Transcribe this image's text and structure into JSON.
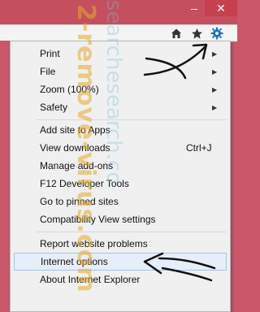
{
  "window": {
    "minimize_glyph": "–",
    "close_glyph": "✕"
  },
  "toolbar": {
    "icons": [
      "home-icon",
      "favorites-star-icon",
      "tools-gear-icon"
    ]
  },
  "menu": {
    "items": [
      {
        "label": "Print",
        "has_submenu": true
      },
      {
        "label": "File",
        "has_submenu": true
      },
      {
        "label": "Zoom (100%)",
        "has_submenu": true
      },
      {
        "label": "Safety",
        "has_submenu": true
      },
      {
        "label": "Add site to Apps"
      },
      {
        "label": "View downloads",
        "accelerator": "Ctrl+J"
      },
      {
        "label": "Manage add-ons"
      },
      {
        "label": "F12 Developer Tools"
      },
      {
        "label": "Go to pinned sites"
      },
      {
        "label": "Compatibility View settings"
      },
      {
        "label": "Report website problems"
      },
      {
        "label": "Internet options",
        "selected": true
      },
      {
        "label": "About Internet Explorer"
      }
    ],
    "arrow_glyph": "▶"
  },
  "watermark": {
    "text": "2-remove-virus.com",
    "text2": "searchesearch.co"
  },
  "colors": {
    "frame": "#c4505f",
    "close_button": "#c7404f",
    "menu_bg": "#f0f0f0",
    "selected_bg": "#e6eefb",
    "selected_border": "#a7c1e8",
    "gear": "#1a6fc2"
  }
}
